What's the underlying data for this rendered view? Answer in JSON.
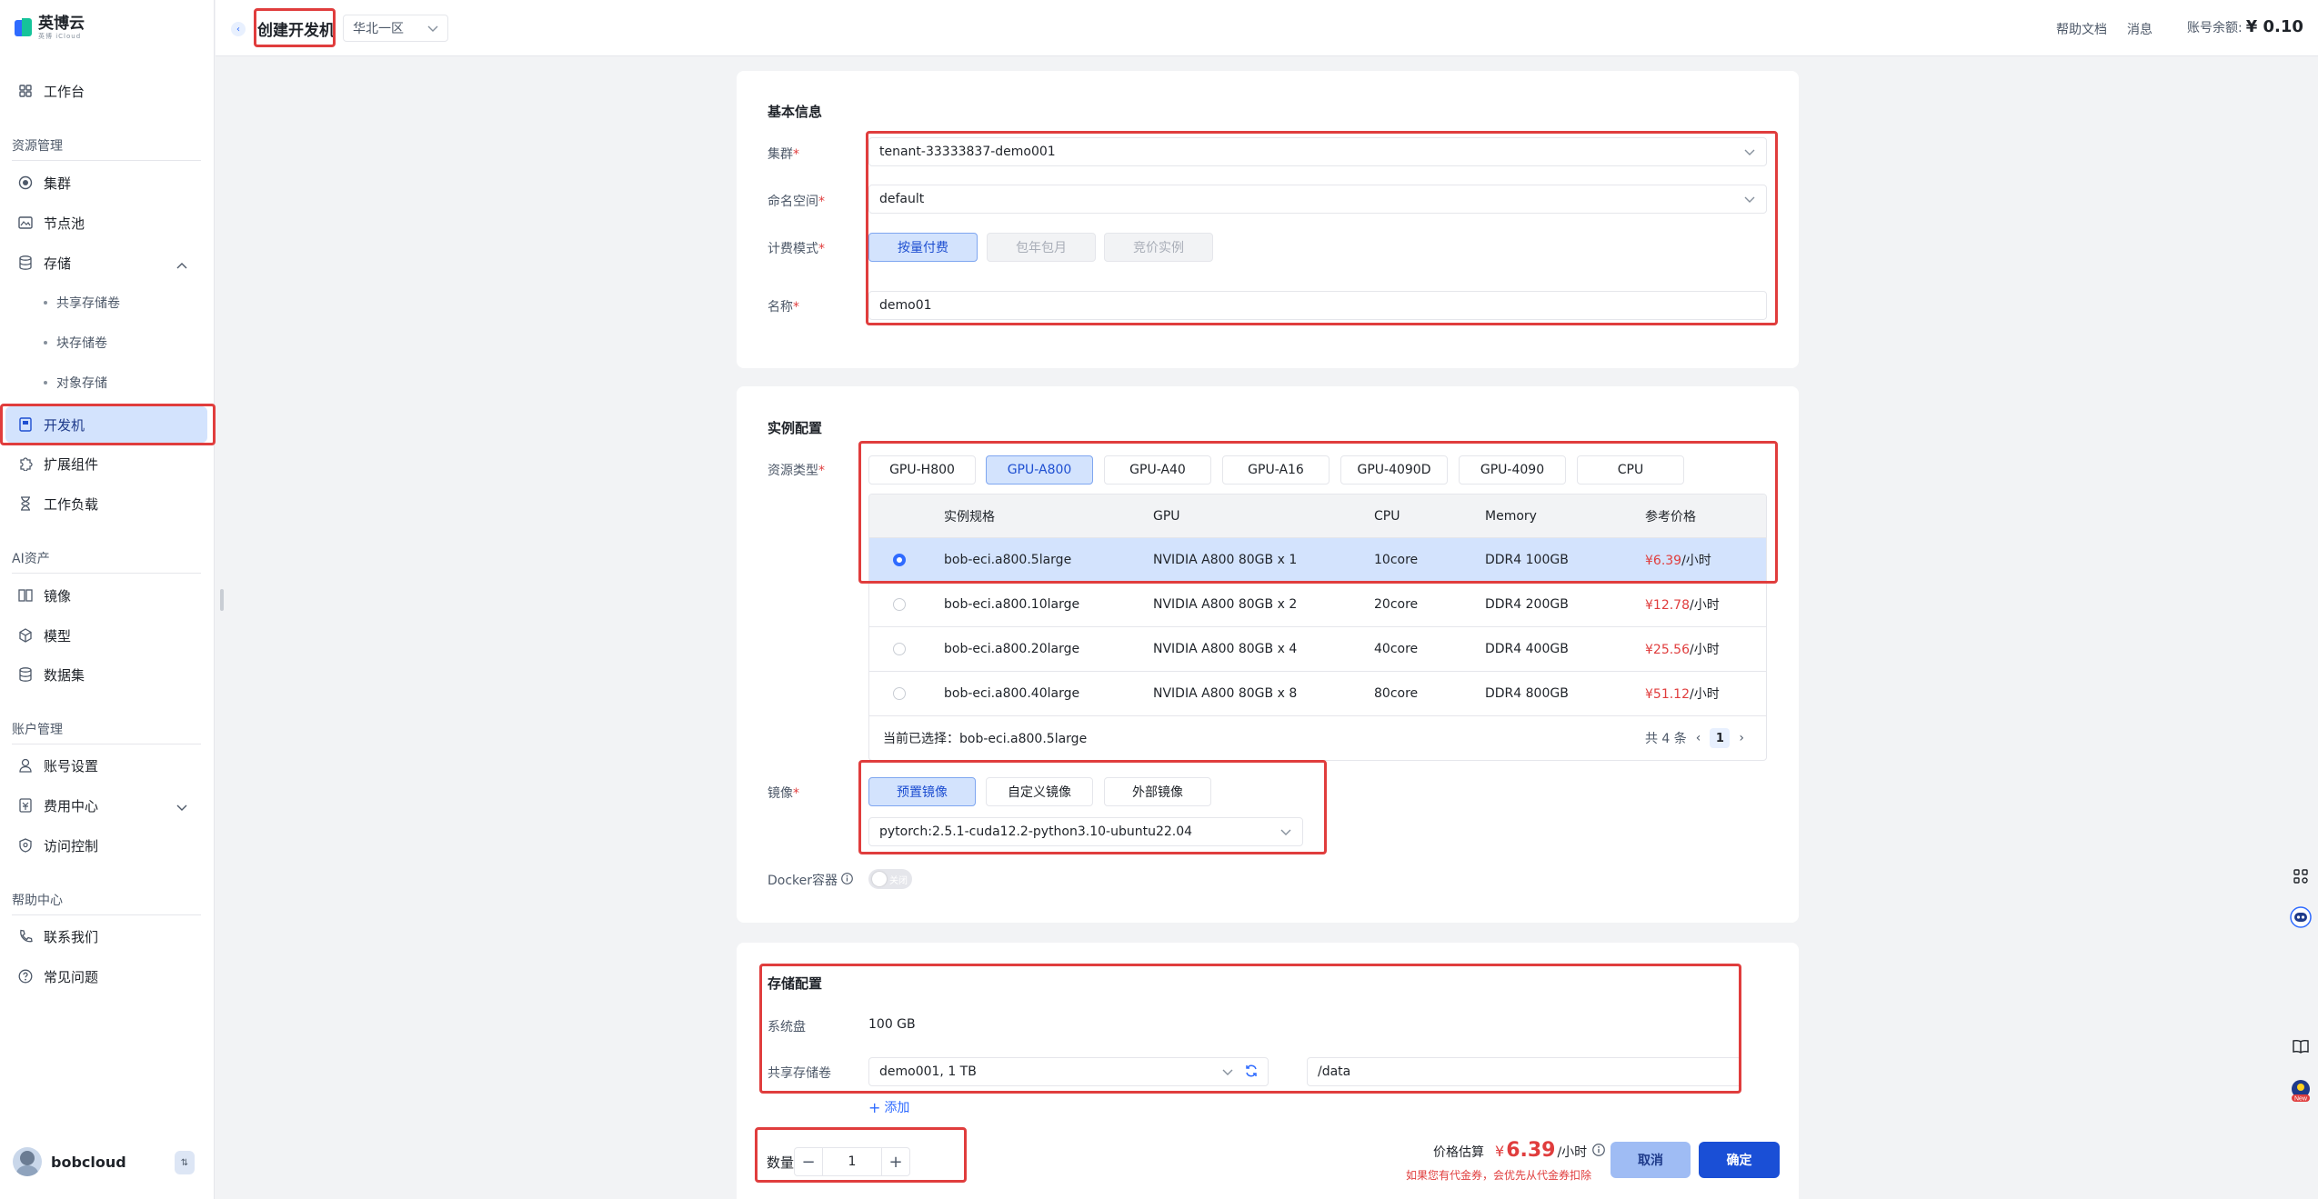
{
  "brand": {
    "name": "英博云",
    "sub": "英博 iCloud"
  },
  "sidebar": {
    "workbench": "工作台",
    "groups": {
      "resource": "资源管理",
      "ai": "AI资产",
      "account": "账户管理",
      "help": "帮助中心"
    },
    "items": {
      "cluster": "集群",
      "nodepool": "节点池",
      "storage": "存储",
      "shared_volume": "共享存储卷",
      "block_volume": "块存储卷",
      "object_storage": "对象存储",
      "devbox": "开发机",
      "extensions": "扩展组件",
      "workloads": "工作负载",
      "images": "镜像",
      "models": "模型",
      "datasets": "数据集",
      "account_settings": "账号设置",
      "billing": "费用中心",
      "access_control": "访问控制",
      "contact": "联系我们",
      "faq": "常见问题"
    },
    "user": "bobcloud"
  },
  "header": {
    "title": "创建开发机",
    "region": "华北一区",
    "help_docs": "帮助文档",
    "messages": "消息",
    "balance_label": "账号余额:",
    "balance_value": "¥ 0.10"
  },
  "basic": {
    "title": "基本信息",
    "cluster_label": "集群",
    "cluster_value": "tenant-33333837-demo001",
    "namespace_label": "命名空间",
    "namespace_value": "default",
    "billing_label": "计费模式",
    "billing_options": [
      "按量付费",
      "包年包月",
      "竞价实例"
    ],
    "name_label": "名称",
    "name_value": "demo01"
  },
  "instance": {
    "title": "实例配置",
    "resource_label": "资源类型",
    "resource_types": [
      "GPU-H800",
      "GPU-A800",
      "GPU-A40",
      "GPU-A16",
      "GPU-4090D",
      "GPU-4090",
      "CPU"
    ],
    "columns": [
      "实例规格",
      "GPU",
      "CPU",
      "Memory",
      "参考价格"
    ],
    "rows": [
      {
        "spec": "bob-eci.a800.5large",
        "gpu": "NVIDIA A800 80GB x 1",
        "cpu": "10core",
        "mem": "DDR4 100GB",
        "price": "¥6.39",
        "unit": "/小时"
      },
      {
        "spec": "bob-eci.a800.10large",
        "gpu": "NVIDIA A800 80GB x 2",
        "cpu": "20core",
        "mem": "DDR4 200GB",
        "price": "¥12.78",
        "unit": "/小时"
      },
      {
        "spec": "bob-eci.a800.20large",
        "gpu": "NVIDIA A800 80GB x 4",
        "cpu": "40core",
        "mem": "DDR4 400GB",
        "price": "¥25.56",
        "unit": "/小时"
      },
      {
        "spec": "bob-eci.a800.40large",
        "gpu": "NVIDIA A800 80GB x 8",
        "cpu": "80core",
        "mem": "DDR4 800GB",
        "price": "¥51.12",
        "unit": "/小时"
      }
    ],
    "current_selected": "当前已选择：bob-eci.a800.5large",
    "total": "共 4 条",
    "page": "1",
    "image_label": "镜像",
    "image_options": [
      "预置镜像",
      "自定义镜像",
      "外部镜像"
    ],
    "image_value": "pytorch:2.5.1-cuda12.2-python3.10-ubuntu22.04",
    "docker_label": "Docker容器",
    "docker_switch": "关闭"
  },
  "storage": {
    "title": "存储配置",
    "system_disk_label": "系统盘",
    "system_disk_value": "100 GB",
    "shared_label": "共享存储卷",
    "shared_value": "demo001, 1 TB",
    "mount_path": "/data",
    "add": "添加"
  },
  "footer": {
    "qty_label": "数量",
    "qty_value": "1",
    "price_label": "价格估算",
    "price_currency": "¥",
    "price_value": "6.39",
    "price_unit": "/小时",
    "price_note": "如果您有代金券，会优先从代金券扣除",
    "cancel": "取消",
    "confirm": "确定"
  }
}
